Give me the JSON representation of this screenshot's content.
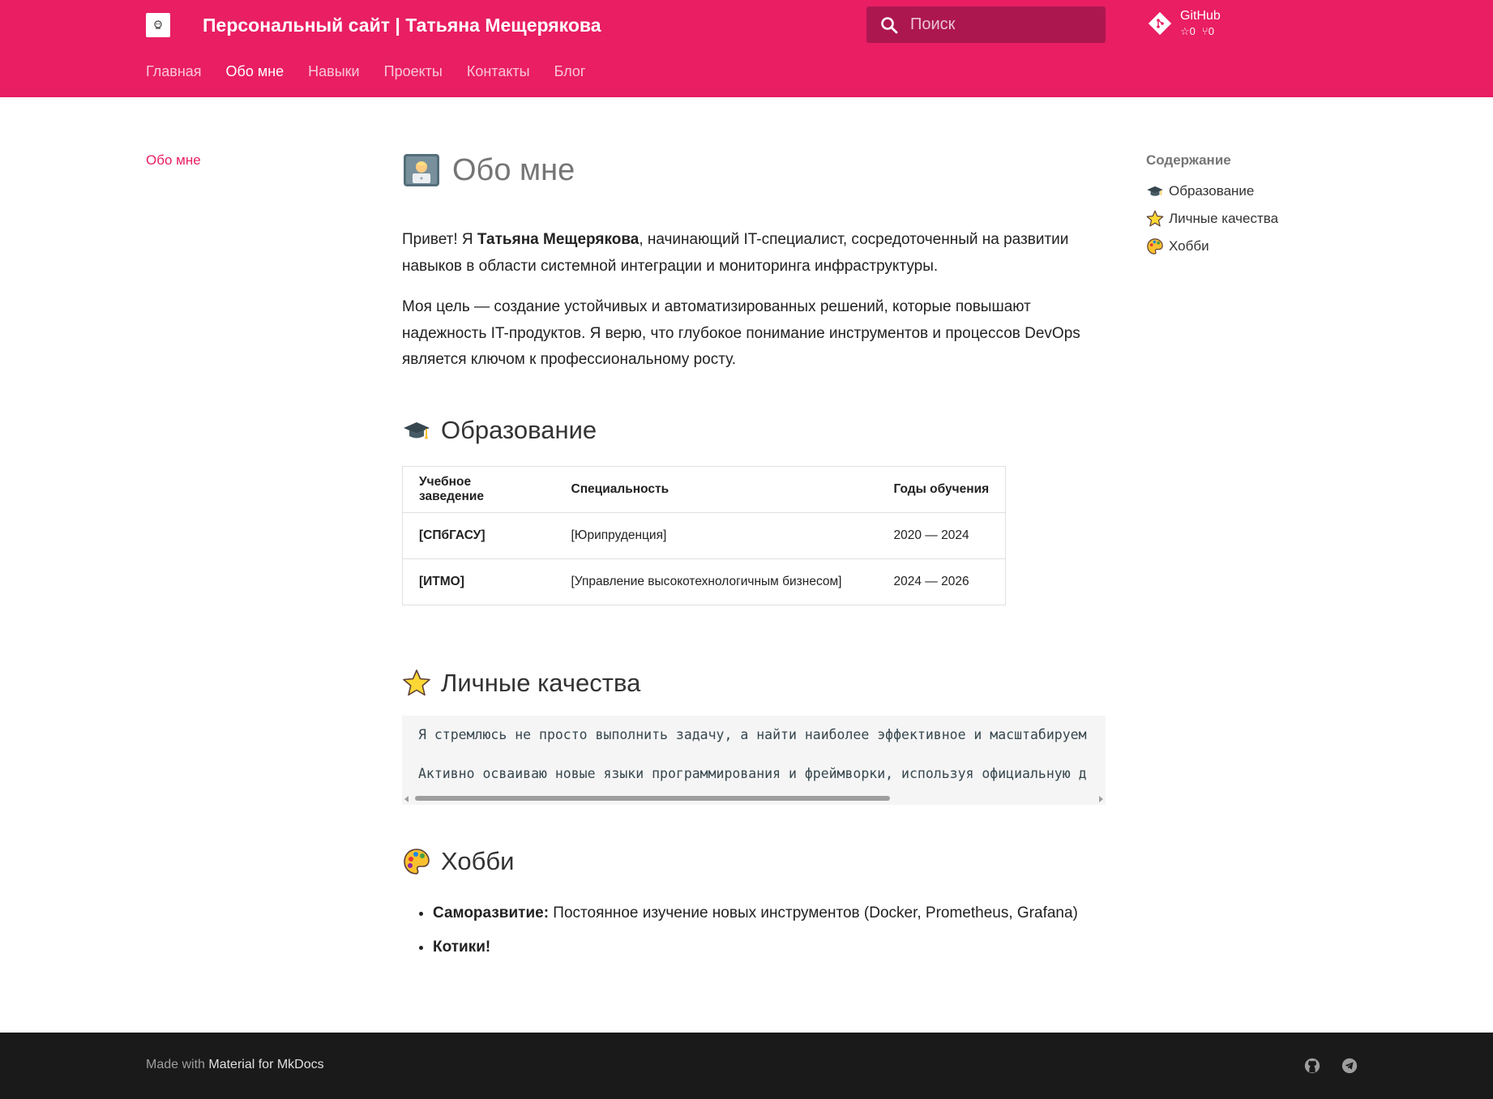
{
  "header": {
    "site_title": "Персональный сайт | Татьяна Мещерякова",
    "search_placeholder": "Поиск",
    "repo": {
      "name": "GitHub",
      "stars": "0",
      "forks": "0"
    },
    "accent_color": "#e91e63"
  },
  "nav": {
    "tabs": [
      {
        "label": "Главная",
        "active": false
      },
      {
        "label": "Обо мне",
        "active": true
      },
      {
        "label": "Навыки",
        "active": false
      },
      {
        "label": "Проекты",
        "active": false
      },
      {
        "label": "Контакты",
        "active": false
      },
      {
        "label": "Блог",
        "active": false
      }
    ]
  },
  "sidebar": {
    "current": "Обо мне"
  },
  "main": {
    "title": "Обо мне",
    "intro": {
      "prefix": "Привет! Я ",
      "name": "Татьяна Мещерякова",
      "suffix": ", начинающий IT-специалист, сосредоточенный на развитии навыков в области системной интеграции и мониторинга инфраструктуры."
    },
    "goal": "Моя цель — создание устойчивых и автоматизированных решений, которые повышают надежность IT-продуктов. Я верю, что глубокое понимание инструментов и процессов DevOps является ключом к профессиональному росту.",
    "education": {
      "heading": "Образование",
      "headers": [
        "Учебное заведение",
        "Специальность",
        "Годы обучения"
      ],
      "rows": [
        {
          "school": "[СПбГАСУ]",
          "specialty": "[Юрипруденция]",
          "years": "2020 — 2024"
        },
        {
          "school": "[ИТМО]",
          "specialty": "[Управление высокотехнологичным бизнесом]",
          "years": "2024 — 2026"
        }
      ]
    },
    "qualities": {
      "heading": "Личные качества",
      "lines": [
        "Я стремлюсь не просто выполнить задачу, а найти наиболее эффективное и масштабируем",
        "Активно осваиваю новые языки программирования и фреймворки, используя официальную д"
      ]
    },
    "hobbies": {
      "heading": "Хобби",
      "items": [
        {
          "label": "Саморазвитие:",
          "text": " Постоянное изучение новых инструментов (Docker, Prometheus, Grafana)"
        },
        {
          "label": "Котики!",
          "text": ""
        }
      ]
    }
  },
  "toc": {
    "title": "Содержание",
    "items": [
      {
        "label": "Образование",
        "icon": "graduation-cap-icon"
      },
      {
        "label": "Личные качества",
        "icon": "star-icon"
      },
      {
        "label": "Хобби",
        "icon": "palette-icon"
      }
    ]
  },
  "footer": {
    "made_with": "Made with ",
    "link": "Material for MkDocs",
    "social": [
      "github-icon",
      "telegram-icon"
    ]
  }
}
